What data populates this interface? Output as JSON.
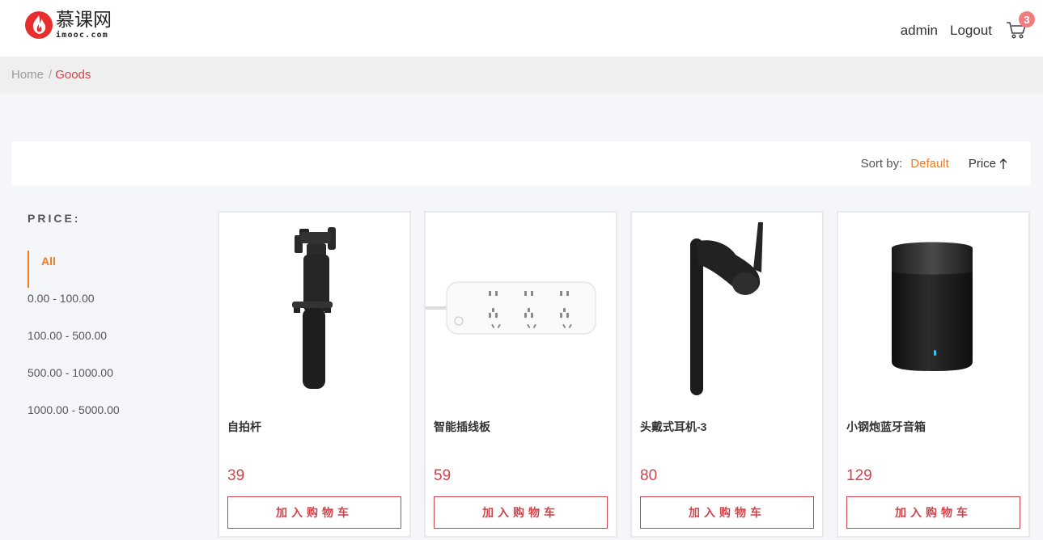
{
  "header": {
    "logo_cn": "慕课网",
    "logo_en": "imooc.com",
    "user_label": "admin",
    "logout_label": "Logout",
    "cart_count": "3"
  },
  "breadcrumb": {
    "home": "Home",
    "separator": "/",
    "current": "Goods"
  },
  "sort": {
    "label": "Sort by:",
    "default_label": "Default",
    "price_label": "Price",
    "price_arrow_icon": "arrow-up-icon"
  },
  "filter": {
    "title": "PRICE:",
    "items": [
      {
        "label": "All",
        "active": true
      },
      {
        "label": "0.00 - 100.00",
        "active": false
      },
      {
        "label": "100.00 - 500.00",
        "active": false
      },
      {
        "label": "500.00 - 1000.00",
        "active": false
      },
      {
        "label": "1000.00 - 5000.00",
        "active": false
      }
    ]
  },
  "products": [
    {
      "name": "自拍杆",
      "price": "39",
      "button": "加入购物车"
    },
    {
      "name": "智能插线板",
      "price": "59",
      "button": "加入购物车"
    },
    {
      "name": "头戴式耳机-3",
      "price": "80",
      "button": "加入购物车"
    },
    {
      "name": "小钢炮蓝牙音箱",
      "price": "129",
      "button": "加入购物车"
    }
  ],
  "colors": {
    "accent_orange": "#ee7a23",
    "accent_red": "#d1434b",
    "badge": "#f07c7c"
  }
}
